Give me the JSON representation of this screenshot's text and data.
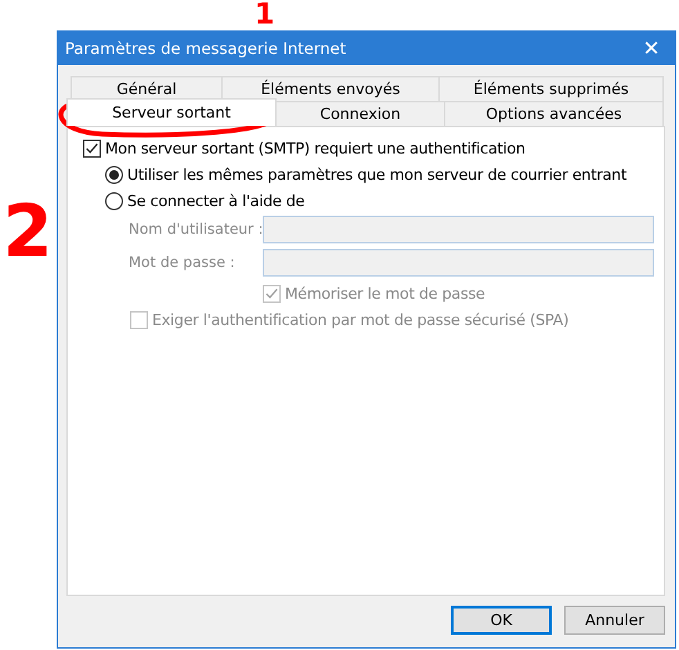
{
  "window": {
    "title": "Paramètres de messagerie Internet",
    "close": "✕"
  },
  "tabs": [
    [
      {
        "label": "Général",
        "selected": false
      },
      {
        "label": "Éléments envoyés",
        "selected": false
      },
      {
        "label": "Éléments supprimés",
        "selected": false
      }
    ],
    [
      {
        "label": "Serveur sortant",
        "selected": true
      },
      {
        "label": "Connexion",
        "selected": false
      },
      {
        "label": "Options avancées",
        "selected": false
      }
    ]
  ],
  "auth": {
    "label": "Mon serveur sortant (SMTP) requiert une authentification",
    "checked": true
  },
  "options": [
    {
      "label": "Utiliser les mêmes paramètres que mon serveur de courrier entrant",
      "selected": true
    },
    {
      "label": "Se connecter à l'aide de",
      "selected": false
    }
  ],
  "fields": [
    {
      "label": "Nom d'utilisateur :",
      "disabled": true
    },
    {
      "label": "Mot de passe :",
      "disabled": true
    }
  ],
  "remember": {
    "label": "Mémoriser le mot de passe",
    "checked": true,
    "disabled": true
  },
  "spa": {
    "label": "Exiger l'authentification par mot de passe sécurisé (SPA)",
    "checked": false,
    "disabled": true
  },
  "buttons": [
    {
      "label": "OK",
      "default": true
    },
    {
      "label": "Annuler",
      "default": false
    }
  ],
  "annotations": [
    {
      "kind": "mark",
      "text": "1"
    },
    {
      "kind": "ellipse"
    },
    {
      "kind": "mark",
      "text": "2"
    }
  ]
}
